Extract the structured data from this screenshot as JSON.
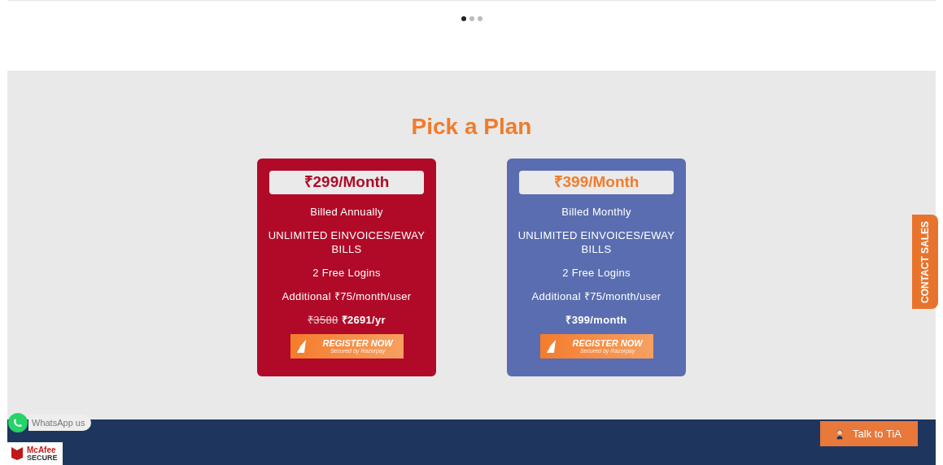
{
  "carousel": {
    "dots": [
      {
        "selected": true
      },
      {
        "selected": false
      },
      {
        "selected": false
      }
    ]
  },
  "pricing": {
    "title": "Pick a Plan",
    "plans": [
      {
        "color": "#b00a28",
        "price": {
          "text": "₹299/Month",
          "color": "#b00a28"
        },
        "features": [
          "Billed Annually",
          "UNLIMITED EINVOICES/EWAY BILLS",
          "2 Free Logins",
          "Additional ₹75/month/user"
        ],
        "old_total": "₹3588",
        "total": "₹2691/yr",
        "button": {
          "label": "REGISTER NOW",
          "sublabel": "Secured by Razorpay"
        }
      },
      {
        "color": "#5a6db0",
        "price": {
          "text": "₹399/Month",
          "color": "#f07c2c"
        },
        "features": [
          "Billed Monthly",
          "UNLIMITED EINVOICES/EWAY BILLS",
          "2 Free Logins",
          "Additional ₹75/month/user"
        ],
        "total": "₹399/month",
        "button": {
          "label": "REGISTER NOW",
          "sublabel": "Secured by Razorpay"
        }
      }
    ]
  },
  "contact_tab": "CONTACT SALES",
  "whatsapp": "WhatsApp us",
  "mcafee": {
    "line1": "McAfee",
    "line2": "SECURE"
  },
  "chat_button": "Talk to TiA"
}
